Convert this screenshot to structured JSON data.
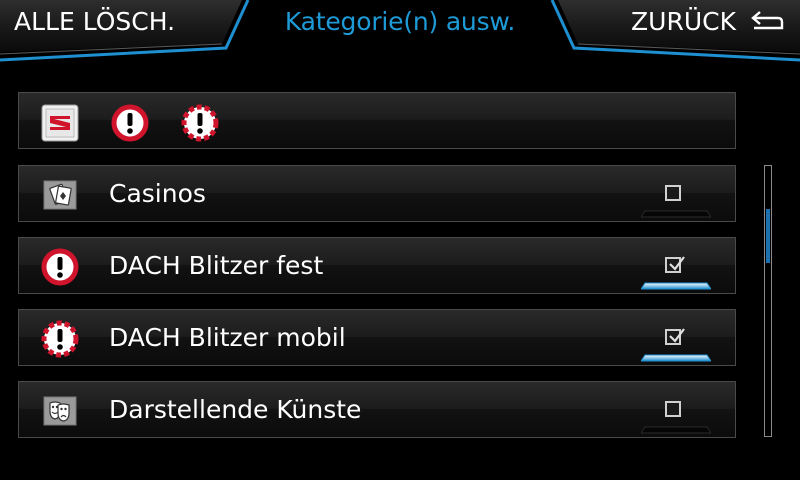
{
  "header": {
    "clear_label": "ALLE LÖSCH.",
    "title": "Kategorie(n) ausw.",
    "back_label": "ZURÜCK"
  },
  "icon_bar": {
    "icons": [
      "seat-logo-icon",
      "speed-camera-fixed-icon",
      "speed-camera-mobile-icon"
    ]
  },
  "categories": [
    {
      "icon": "casino-cards-icon",
      "label": "Casinos",
      "checked": false
    },
    {
      "icon": "speed-camera-fixed-icon",
      "label": "DACH Blitzer fest",
      "checked": true
    },
    {
      "icon": "speed-camera-mobile-icon",
      "label": "DACH Blitzer mobil",
      "checked": true
    },
    {
      "icon": "theater-masks-icon",
      "label": "Darstellende Künste",
      "checked": false
    }
  ],
  "colors": {
    "accent": "#1e9bd7",
    "background": "#000000",
    "warning_red": "#d0142c"
  },
  "scroll_position": 0.2
}
